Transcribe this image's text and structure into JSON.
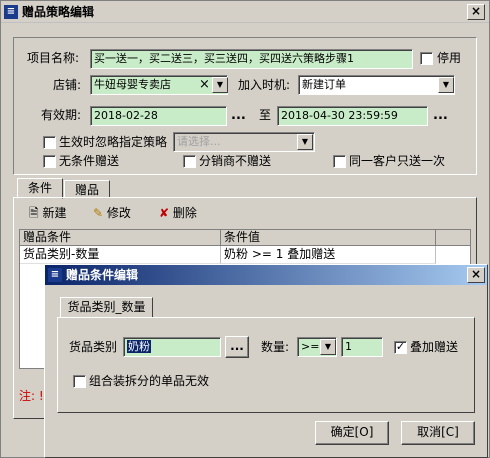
{
  "window": {
    "title": "赠品策略编辑",
    "close": "×"
  },
  "form": {
    "project_label": "项目名称:",
    "project_value": "买一送一，买二送三，买三送四，买四送六策略步骤1",
    "disable_label": "停用",
    "store_label": "店铺:",
    "store_value": "牛妞母婴专卖店",
    "store_clear": "×",
    "join_label": "加入时机:",
    "join_value": "新建订单",
    "valid_label": "有效期:",
    "valid_from": "2018-02-28",
    "valid_to_label": "至",
    "valid_to": "2018-04-30 23:59:59",
    "ignore_label": "生效时忽略指定策略",
    "ignore_placeholder": "请选择...",
    "no_condition_label": "无条件赠送",
    "distributor_label": "分销商不赠送",
    "same_customer_label": "同一客户只送一次",
    "dots": "..."
  },
  "tabs": [
    "条件",
    "赠品"
  ],
  "toolbar": {
    "new": "新建",
    "edit": "修改",
    "delete": "删除"
  },
  "grid": {
    "headers": [
      "赠品条件",
      "条件值"
    ],
    "rows": [
      {
        "condition": "货品类别-数量",
        "value": "奶粉 >= 1 叠加赠送"
      }
    ]
  },
  "note_prefix": "注: !",
  "dialog": {
    "title": "赠品条件编辑",
    "close": "×",
    "tab": "货品类别_数量",
    "category_label": "货品类别",
    "category_value": "奶粉",
    "qty_label": "数量:",
    "op_value": ">=",
    "qty_value": "1",
    "stack_label": "叠加赠送",
    "combo_label": "组合装拆分的单品无效",
    "ok": "确定[O]",
    "cancel": "取消[C]",
    "dots": "..."
  },
  "colors": {
    "field_green": "#c8ecc8",
    "title_blue": "#0a246a",
    "note_red": "#d00000"
  }
}
